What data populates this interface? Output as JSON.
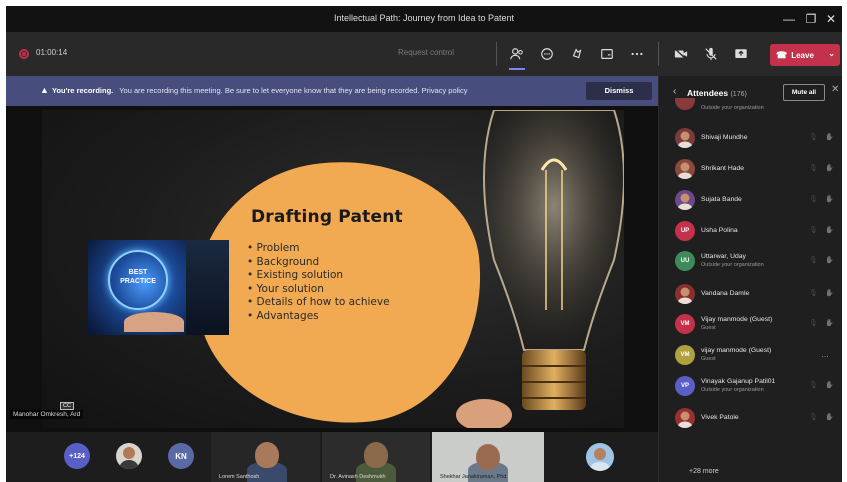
{
  "window": {
    "title": "Intellectual Path: Journey from Idea to Patent"
  },
  "toolbar": {
    "timer": "01:00:14",
    "request_control": "Request control",
    "leave_label": "Leave"
  },
  "banner": {
    "bold": "You're recording.",
    "message": "You are recording this meeting. Be sure to let everyone know that they are being recorded. Privacy policy",
    "dismiss_label": "Dismiss"
  },
  "slide": {
    "title": "Drafting Patent",
    "bullets": [
      "Problem",
      "Background",
      "Existing solution",
      "Your solution",
      "Details of how to achieve",
      "Advantages"
    ],
    "image_text": "BEST PRACTICE",
    "cc_label": "CC",
    "presenter_label": "Manohar Omkresh, Ard"
  },
  "strip": {
    "overflow_count": "+124",
    "initials_tile": "KN",
    "video_names": [
      "Lorem Santhosh",
      "Dr. Avinash Deshmukh",
      "Shekhar Janakiraman, Phd"
    ]
  },
  "attendees": {
    "title": "Attendees",
    "count": "(176)",
    "mute_all": "Mute all",
    "partial_sub": "Outside your organization",
    "people": [
      {
        "name": "Shivaji Mundhe",
        "sub": "",
        "initials": "",
        "color": "#7a3b3b"
      },
      {
        "name": "Shrikant Hade",
        "sub": "",
        "initials": "",
        "color": "#8a4a3a"
      },
      {
        "name": "Sujata Bande",
        "sub": "",
        "initials": "",
        "color": "#6a4a8a"
      },
      {
        "name": "Usha Polina",
        "sub": "",
        "initials": "UP",
        "color": "#c4314b"
      },
      {
        "name": "Uttarwar, Uday",
        "sub": "Outside your organization",
        "initials": "UU",
        "color": "#3d8b5a"
      },
      {
        "name": "Vandana Damle",
        "sub": "",
        "initials": "",
        "color": "#8a2f2f"
      },
      {
        "name": "Vijay manmode (Guest)",
        "sub": "Guest",
        "initials": "VM",
        "color": "#c4314b"
      },
      {
        "name": "vijay manmode (Guest)",
        "sub": "Guest",
        "initials": "VM",
        "color": "#b0a040"
      },
      {
        "name": "Vinayak Gajanup Patil01",
        "sub": "Outside your organization",
        "initials": "VP",
        "color": "#5a5fc7"
      },
      {
        "name": "Vivek Patole",
        "sub": "",
        "initials": "",
        "color": "#9a3030"
      }
    ],
    "more": "+28 more"
  }
}
